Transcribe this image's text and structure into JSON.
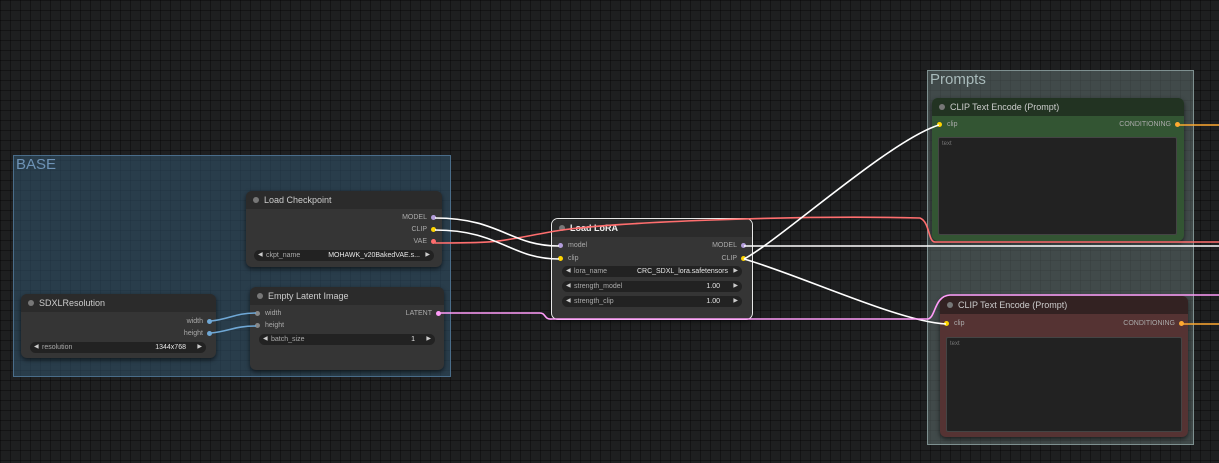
{
  "colors": {
    "model_link": "#ffffff",
    "clip_link": "#ffffff",
    "vae_link": "#ff6e6e",
    "latent_link": "#ff9cf9",
    "int_link": "#6fa8d6",
    "conditioning_link": "#ffa931"
  },
  "groups": {
    "base": {
      "title": "BASE"
    },
    "prompts": {
      "title": "Prompts"
    }
  },
  "nodes": {
    "load_checkpoint": {
      "title": "Load Checkpoint",
      "outputs": [
        "MODEL",
        "CLIP",
        "VAE"
      ],
      "ckpt_name": {
        "label": "ckpt_name",
        "value": "MOHAWK_v20BakedVAE.s..."
      }
    },
    "empty_latent": {
      "title": "Empty Latent Image",
      "inputs": [
        "width",
        "height"
      ],
      "output": "LATENT",
      "batch_size": {
        "label": "batch_size",
        "value": "1"
      }
    },
    "sdxl_resolution": {
      "title": "SDXLResolution",
      "outputs": [
        "width",
        "height"
      ],
      "resolution": {
        "label": "resolution",
        "value": "1344x768"
      }
    },
    "load_lora": {
      "title": "Load LoRA",
      "inputs": [
        "model",
        "clip"
      ],
      "outputs": [
        "MODEL",
        "CLIP"
      ],
      "lora_name": {
        "label": "lora_name",
        "value": "CRC_SDXL_lora.safetensors"
      },
      "strength_model": {
        "label": "strength_model",
        "value": "1.00"
      },
      "strength_clip": {
        "label": "strength_clip",
        "value": "1.00"
      }
    },
    "clip_pos": {
      "title": "CLIP Text Encode (Prompt)",
      "input": "clip",
      "output": "CONDITIONING",
      "text_placeholder": "text"
    },
    "clip_neg": {
      "title": "CLIP Text Encode (Prompt)",
      "input": "clip",
      "output": "CONDITIONING",
      "text_placeholder": "text"
    }
  }
}
